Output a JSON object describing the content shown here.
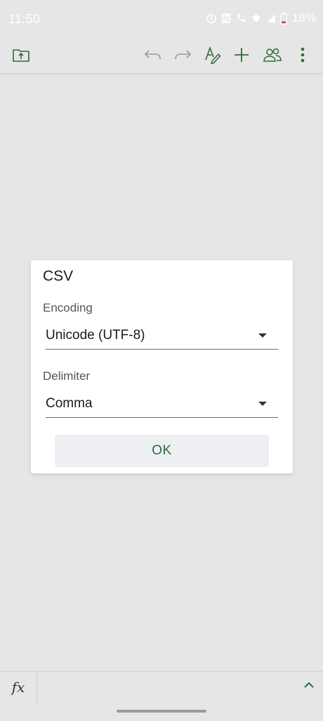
{
  "status_bar": {
    "time": "11:50",
    "battery": "18%",
    "icons": [
      "alarm-icon",
      "nfc-icon",
      "wifi-calling-icon",
      "data-icon",
      "signal-icon",
      "battery-icon"
    ]
  },
  "toolbar": {
    "icons": [
      "folder-upload-icon",
      "undo-icon",
      "redo-icon",
      "draw-icon",
      "add-icon",
      "share-people-icon",
      "more-vert-icon"
    ],
    "accent_color": "#2e6b3c"
  },
  "dialog": {
    "title": "CSV",
    "encoding": {
      "label": "Encoding",
      "value": "Unicode (UTF-8)"
    },
    "delimiter": {
      "label": "Delimiter",
      "value": "Comma"
    },
    "ok_label": "OK"
  },
  "bottom_bar": {
    "fx_label": "fx"
  }
}
